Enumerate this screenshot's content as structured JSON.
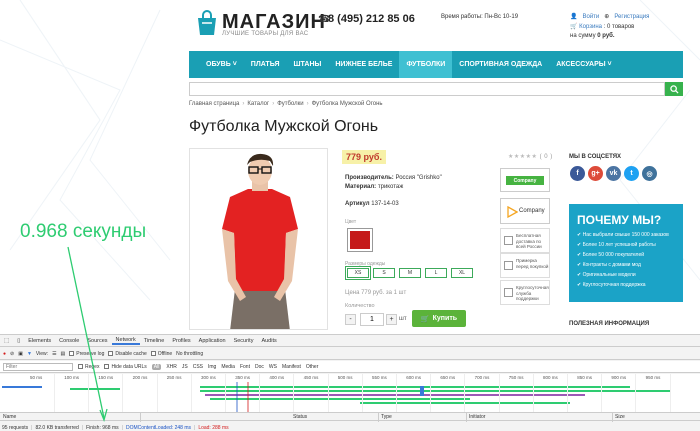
{
  "header": {
    "logo_name": "МАГАЗИН",
    "logo_tagline": "ЛУЧШИЕ ТОВАРЫ ДЛЯ ВАС",
    "phone": "8 (495) 212 85 06",
    "hours": "Время работы: Пн-Вс 10-19",
    "login": "Войти",
    "register": "Регистрация",
    "cart_label": "Корзина",
    "cart_items": ": 0 товаров",
    "cart_sum_label": "на сумму",
    "cart_sum": "0 руб."
  },
  "nav": {
    "items": [
      {
        "label": "ОБУВЬ ˅"
      },
      {
        "label": "ПЛАТЬЯ"
      },
      {
        "label": "ШТАНЫ"
      },
      {
        "label": "НИЖНЕЕ БЕЛЬЕ"
      },
      {
        "label": "ФУТБОЛКИ"
      },
      {
        "label": "СПОРТИВНАЯ ОДЕЖДА"
      },
      {
        "label": "АКСЕССУАРЫ ˅"
      }
    ]
  },
  "breadcrumb": [
    "Главная страница",
    "Каталог",
    "Футболки",
    "Футболка Мужской Огонь"
  ],
  "breadcrumb_sep": "›",
  "product": {
    "title": "Футболка Мужской Огонь",
    "price": "779 руб.",
    "manufacturer_label": "Производитель:",
    "manufacturer": "Россия \"Grishko\"",
    "material_label": "Материал:",
    "material": "трикотаж",
    "article_label": "Артикул",
    "article": "137-14-03",
    "color_label": "Цвет",
    "color_hex": "#c51a1a",
    "sizes_label": "Размеры одежды",
    "sizes": [
      "XS",
      "S",
      "M",
      "L",
      "XL"
    ],
    "unit_price": "Цена 779 руб. за 1 шт",
    "quantity_label": "Количество",
    "quantity_value": "1",
    "minus": "-",
    "plus": "+",
    "unit": "шт",
    "buy_label": "Купить"
  },
  "sidebar": {
    "rating_count": "( 0 )",
    "company1": "Company",
    "company2": "Company",
    "services": [
      {
        "text": "Бесплатная доставка по всей России"
      },
      {
        "text": "Примерка перед покупкой"
      },
      {
        "text": "Круглосуточная служба поддержки"
      }
    ],
    "social_title": "МЫ В СОЦСЕТЯХ",
    "social_icons": [
      {
        "label": "f",
        "color": "#3b5998",
        "name": "facebook-icon"
      },
      {
        "label": "g+",
        "color": "#dd4b39",
        "name": "google-plus-icon"
      },
      {
        "label": "vk",
        "color": "#4c75a3",
        "name": "vk-icon"
      },
      {
        "label": "t",
        "color": "#1da1f2",
        "name": "twitter-icon"
      },
      {
        "label": "◎",
        "color": "#3f729b",
        "name": "instagram-icon"
      }
    ],
    "why_title": "ПОЧЕМУ МЫ?",
    "why_items": [
      "Нас выбрали свыше 150 000 заказов",
      "Более 10 лет успешной работы",
      "Более 50 000 покупателей",
      "Контракты с домами мод",
      "Оригинальные модели",
      "Круглосуточная поддержка"
    ],
    "useful_title": "ПОЛЕЗНАЯ ИНФОРМАЦИЯ"
  },
  "annotation": "0.968 секунды",
  "devtools": {
    "tabs": [
      "Elements",
      "Console",
      "Sources",
      "Network",
      "Timeline",
      "Profiles",
      "Application",
      "Security",
      "Audits"
    ],
    "active_tab": "Network",
    "view_label": "View:",
    "preserve_log": "Preserve log",
    "disable_cache": "Disable cache",
    "offline": "Offline",
    "throttling": "No throttling",
    "filter_placeholder": "Filter",
    "regex": "Regex",
    "hide_data_urls": "Hide data URLs",
    "types": [
      "All",
      "XHR",
      "JS",
      "CSS",
      "Img",
      "Media",
      "Font",
      "Doc",
      "WS",
      "Manifest",
      "Other"
    ],
    "ticks": [
      "50 ms",
      "100 ms",
      "150 ms",
      "200 ms",
      "250 ms",
      "300 ms",
      "350 ms",
      "400 ms",
      "450 ms",
      "500 ms",
      "550 ms",
      "600 ms",
      "650 ms",
      "700 ms",
      "750 ms",
      "800 ms",
      "850 ms",
      "900 ms",
      "950 ms"
    ],
    "columns": [
      "Name",
      "Status",
      "Type",
      "Initiator",
      "Size"
    ],
    "requests": "95 requests",
    "transferred": "82.0 KB transferred",
    "finish": "Finish: 968 ms",
    "dom_content_loaded": "DOMContentLoaded: 248 ms",
    "load": "Load: 288 ms"
  }
}
